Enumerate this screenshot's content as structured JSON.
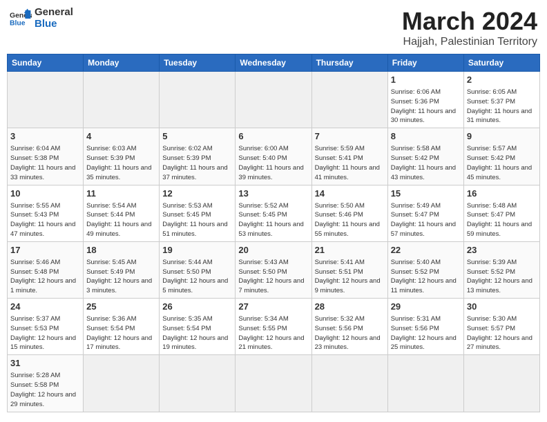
{
  "header": {
    "logo_general": "General",
    "logo_blue": "Blue",
    "month_title": "March 2024",
    "subtitle": "Hajjah, Palestinian Territory"
  },
  "days_of_week": [
    "Sunday",
    "Monday",
    "Tuesday",
    "Wednesday",
    "Thursday",
    "Friday",
    "Saturday"
  ],
  "weeks": [
    [
      {
        "day": "",
        "info": "",
        "empty": true
      },
      {
        "day": "",
        "info": "",
        "empty": true
      },
      {
        "day": "",
        "info": "",
        "empty": true
      },
      {
        "day": "",
        "info": "",
        "empty": true
      },
      {
        "day": "",
        "info": "",
        "empty": true
      },
      {
        "day": "1",
        "info": "Sunrise: 6:06 AM\nSunset: 5:36 PM\nDaylight: 11 hours\nand 30 minutes.",
        "empty": false
      },
      {
        "day": "2",
        "info": "Sunrise: 6:05 AM\nSunset: 5:37 PM\nDaylight: 11 hours\nand 31 minutes.",
        "empty": false
      }
    ],
    [
      {
        "day": "3",
        "info": "Sunrise: 6:04 AM\nSunset: 5:38 PM\nDaylight: 11 hours\nand 33 minutes.",
        "empty": false
      },
      {
        "day": "4",
        "info": "Sunrise: 6:03 AM\nSunset: 5:39 PM\nDaylight: 11 hours\nand 35 minutes.",
        "empty": false
      },
      {
        "day": "5",
        "info": "Sunrise: 6:02 AM\nSunset: 5:39 PM\nDaylight: 11 hours\nand 37 minutes.",
        "empty": false
      },
      {
        "day": "6",
        "info": "Sunrise: 6:00 AM\nSunset: 5:40 PM\nDaylight: 11 hours\nand 39 minutes.",
        "empty": false
      },
      {
        "day": "7",
        "info": "Sunrise: 5:59 AM\nSunset: 5:41 PM\nDaylight: 11 hours\nand 41 minutes.",
        "empty": false
      },
      {
        "day": "8",
        "info": "Sunrise: 5:58 AM\nSunset: 5:42 PM\nDaylight: 11 hours\nand 43 minutes.",
        "empty": false
      },
      {
        "day": "9",
        "info": "Sunrise: 5:57 AM\nSunset: 5:42 PM\nDaylight: 11 hours\nand 45 minutes.",
        "empty": false
      }
    ],
    [
      {
        "day": "10",
        "info": "Sunrise: 5:55 AM\nSunset: 5:43 PM\nDaylight: 11 hours\nand 47 minutes.",
        "empty": false
      },
      {
        "day": "11",
        "info": "Sunrise: 5:54 AM\nSunset: 5:44 PM\nDaylight: 11 hours\nand 49 minutes.",
        "empty": false
      },
      {
        "day": "12",
        "info": "Sunrise: 5:53 AM\nSunset: 5:45 PM\nDaylight: 11 hours\nand 51 minutes.",
        "empty": false
      },
      {
        "day": "13",
        "info": "Sunrise: 5:52 AM\nSunset: 5:45 PM\nDaylight: 11 hours\nand 53 minutes.",
        "empty": false
      },
      {
        "day": "14",
        "info": "Sunrise: 5:50 AM\nSunset: 5:46 PM\nDaylight: 11 hours\nand 55 minutes.",
        "empty": false
      },
      {
        "day": "15",
        "info": "Sunrise: 5:49 AM\nSunset: 5:47 PM\nDaylight: 11 hours\nand 57 minutes.",
        "empty": false
      },
      {
        "day": "16",
        "info": "Sunrise: 5:48 AM\nSunset: 5:47 PM\nDaylight: 11 hours\nand 59 minutes.",
        "empty": false
      }
    ],
    [
      {
        "day": "17",
        "info": "Sunrise: 5:46 AM\nSunset: 5:48 PM\nDaylight: 12 hours\nand 1 minute.",
        "empty": false
      },
      {
        "day": "18",
        "info": "Sunrise: 5:45 AM\nSunset: 5:49 PM\nDaylight: 12 hours\nand 3 minutes.",
        "empty": false
      },
      {
        "day": "19",
        "info": "Sunrise: 5:44 AM\nSunset: 5:50 PM\nDaylight: 12 hours\nand 5 minutes.",
        "empty": false
      },
      {
        "day": "20",
        "info": "Sunrise: 5:43 AM\nSunset: 5:50 PM\nDaylight: 12 hours\nand 7 minutes.",
        "empty": false
      },
      {
        "day": "21",
        "info": "Sunrise: 5:41 AM\nSunset: 5:51 PM\nDaylight: 12 hours\nand 9 minutes.",
        "empty": false
      },
      {
        "day": "22",
        "info": "Sunrise: 5:40 AM\nSunset: 5:52 PM\nDaylight: 12 hours\nand 11 minutes.",
        "empty": false
      },
      {
        "day": "23",
        "info": "Sunrise: 5:39 AM\nSunset: 5:52 PM\nDaylight: 12 hours\nand 13 minutes.",
        "empty": false
      }
    ],
    [
      {
        "day": "24",
        "info": "Sunrise: 5:37 AM\nSunset: 5:53 PM\nDaylight: 12 hours\nand 15 minutes.",
        "empty": false
      },
      {
        "day": "25",
        "info": "Sunrise: 5:36 AM\nSunset: 5:54 PM\nDaylight: 12 hours\nand 17 minutes.",
        "empty": false
      },
      {
        "day": "26",
        "info": "Sunrise: 5:35 AM\nSunset: 5:54 PM\nDaylight: 12 hours\nand 19 minutes.",
        "empty": false
      },
      {
        "day": "27",
        "info": "Sunrise: 5:34 AM\nSunset: 5:55 PM\nDaylight: 12 hours\nand 21 minutes.",
        "empty": false
      },
      {
        "day": "28",
        "info": "Sunrise: 5:32 AM\nSunset: 5:56 PM\nDaylight: 12 hours\nand 23 minutes.",
        "empty": false
      },
      {
        "day": "29",
        "info": "Sunrise: 5:31 AM\nSunset: 5:56 PM\nDaylight: 12 hours\nand 25 minutes.",
        "empty": false
      },
      {
        "day": "30",
        "info": "Sunrise: 5:30 AM\nSunset: 5:57 PM\nDaylight: 12 hours\nand 27 minutes.",
        "empty": false
      }
    ],
    [
      {
        "day": "31",
        "info": "Sunrise: 5:28 AM\nSunset: 5:58 PM\nDaylight: 12 hours\nand 29 minutes.",
        "empty": false
      },
      {
        "day": "",
        "info": "",
        "empty": true
      },
      {
        "day": "",
        "info": "",
        "empty": true
      },
      {
        "day": "",
        "info": "",
        "empty": true
      },
      {
        "day": "",
        "info": "",
        "empty": true
      },
      {
        "day": "",
        "info": "",
        "empty": true
      },
      {
        "day": "",
        "info": "",
        "empty": true
      }
    ]
  ]
}
